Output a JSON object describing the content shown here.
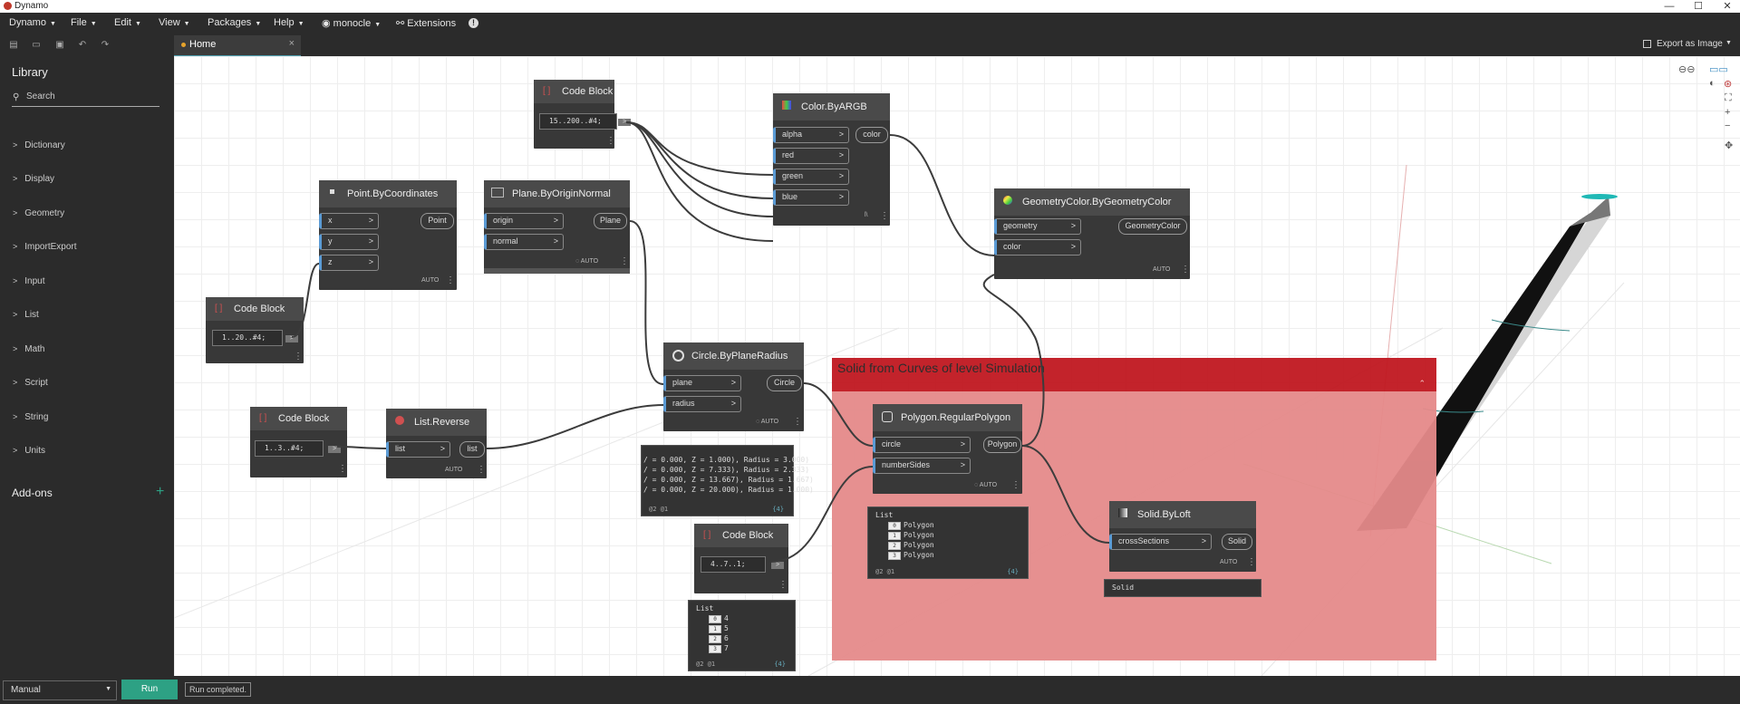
{
  "window": {
    "title": "Dynamo",
    "minimize": "—",
    "maximize": "☐",
    "close": "✕"
  },
  "menu": {
    "dynamo": "Dynamo",
    "file": "File",
    "edit": "Edit",
    "view": "View",
    "packages": "Packages",
    "help": "Help",
    "monocle": "monocle",
    "extensions": "Extensions",
    "info": "!"
  },
  "tab": {
    "label": "Home",
    "close": "×"
  },
  "export": {
    "label": "Export as Image"
  },
  "library": {
    "title": "Library",
    "search_placeholder": "Search",
    "items": [
      "Dictionary",
      "Display",
      "Geometry",
      "ImportExport",
      "Input",
      "List",
      "Math",
      "Script",
      "String",
      "Units"
    ],
    "addons": "Add-ons",
    "addons_plus": "+"
  },
  "nodes": {
    "cb1": {
      "name": "Code Block",
      "code": "1..20..#4;"
    },
    "cb2": {
      "name": "Code Block",
      "code": "15..200..#4;"
    },
    "cb3": {
      "name": "Code Block",
      "code": "1..3..#4;"
    },
    "cb4": {
      "name": "Code Block",
      "code": "4..7..1;"
    },
    "point": {
      "name": "Point.ByCoordinates",
      "in": [
        "x",
        "y",
        "z"
      ],
      "out": "Point",
      "lacing": "AUTO"
    },
    "plane": {
      "name": "Plane.ByOriginNormal",
      "in": [
        "origin",
        "normal"
      ],
      "out": "Plane",
      "lacing": "AUTO"
    },
    "color": {
      "name": "Color.ByARGB",
      "in": [
        "alpha",
        "red",
        "green",
        "blue"
      ],
      "out": "color",
      "lacing": "l\\"
    },
    "geocolor": {
      "name": "GeometryColor.ByGeometryColor",
      "in": [
        "geometry",
        "color"
      ],
      "out": "GeometryColor",
      "lacing": "AUTO"
    },
    "reverse": {
      "name": "List.Reverse",
      "in": [
        "list"
      ],
      "out": "list",
      "lacing": "AUTO"
    },
    "circle": {
      "name": "Circle.ByPlaneRadius",
      "in": [
        "plane",
        "radius"
      ],
      "out": "Circle",
      "lacing": "AUTO"
    },
    "polygon": {
      "name": "Polygon.RegularPolygon",
      "in": [
        "circle",
        "numberSides"
      ],
      "out": "Polygon",
      "lacing": "AUTO"
    },
    "loft": {
      "name": "Solid.ByLoft",
      "in": [
        "crossSections"
      ],
      "out": "Solid",
      "lacing": "AUTO",
      "preview": "Solid"
    }
  },
  "group": {
    "title": "Solid from Curves of level Simulation"
  },
  "previews": {
    "circle": {
      "lines": [
        "/ = 0.000, Z = 1.000), Radius = 3.000)",
        "/ = 0.000, Z = 7.333), Radius = 2.333)",
        "/ = 0.000, Z = 13.667), Radius = 1.667)",
        "/ = 0.000, Z = 20.000), Radius = 1.000)"
      ],
      "foot": "@2 @1",
      "count": "{4}"
    },
    "polygon": {
      "title": "List",
      "items": [
        {
          "i": "0",
          "v": "Polygon"
        },
        {
          "i": "1",
          "v": "Polygon"
        },
        {
          "i": "2",
          "v": "Polygon"
        },
        {
          "i": "3",
          "v": "Polygon"
        }
      ],
      "foot": "@2 @1",
      "count": "{4}"
    },
    "cb4": {
      "title": "List",
      "items": [
        {
          "i": "0",
          "v": "4"
        },
        {
          "i": "1",
          "v": "5"
        },
        {
          "i": "2",
          "v": "6"
        },
        {
          "i": "3",
          "v": "7"
        }
      ],
      "foot": "@2 @1",
      "count": "{4}"
    }
  },
  "status": {
    "run_mode": "Manual",
    "run_label": "Run",
    "message": "Run completed."
  },
  "colors": {
    "accent": "#2da184",
    "group_header": "#c01820",
    "group_body": "#e58a8a",
    "port_accent": "#5b9bd5"
  }
}
